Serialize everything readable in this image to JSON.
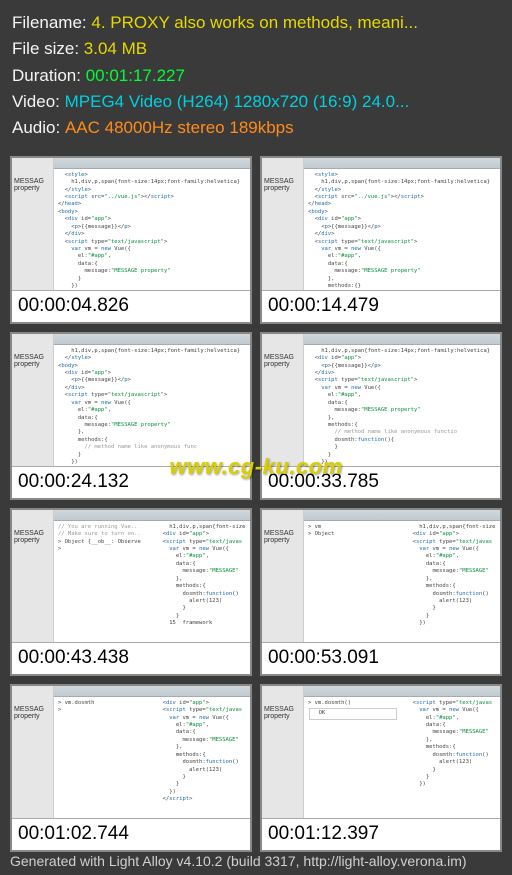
{
  "meta": {
    "filename_label": "Filename: ",
    "filename_value": "4. PROXY also works on methods, meani...",
    "filesize_label": "File size: ",
    "filesize_value": "3.04 MB",
    "duration_label": "Duration: ",
    "duration_value": "00:01:17.227",
    "video_label": "Video: ",
    "video_value": "MPEG4 Video (H264) 1280x720 (16:9) 24.0...",
    "audio_label": "Audio: ",
    "audio_value": "AAC 48000Hz stereo 189kbps"
  },
  "sidebar_text": "MESSAG\nproperty",
  "timestamps": [
    "00:00:04.826",
    "00:00:14.479",
    "00:00:24.132",
    "00:00:33.785",
    "00:00:43.438",
    "00:00:53.091",
    "00:01:02.744",
    "00:01:12.397"
  ],
  "watermark": "www.cg-ku.com",
  "footer": "Generated with Light Alloy v4.10.2 (build 3317, http://light-alloy.verona.im)"
}
